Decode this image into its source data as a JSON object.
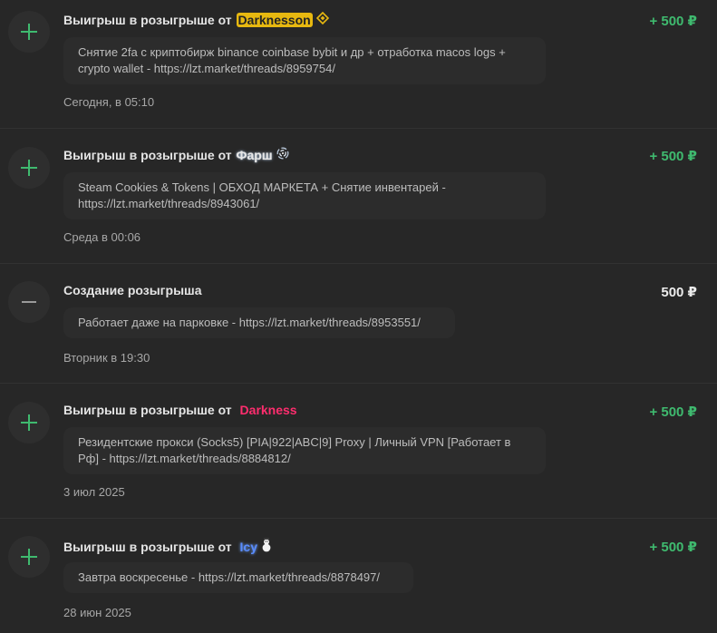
{
  "colors": {
    "background": "#272727",
    "positive_amount": "#3fba6f",
    "plus_icon": "#3fba6f",
    "minus_icon": "#9a9a9a",
    "darknesson_badge": "#e7b810",
    "darkness_name": "#ff2d6e",
    "icy_name": "#5a8cff"
  },
  "entries": [
    {
      "icon": "plus-icon",
      "title_prefix": "Выигрыш в розыгрыше от",
      "username": "Darknesson",
      "username_badge_icon": "binance-diamond-icon",
      "amount": "+ 500 ₽",
      "description": "Снятие 2fa с криптобирж binance coinbase bybit и др + отработка macos logs + crypto wallet - https://lzt.market/threads/8959754/",
      "date": "Сегодня, в 05:10"
    },
    {
      "icon": "plus-icon",
      "title_prefix": "Выигрыш в розыгрыше от",
      "username": "Фарш",
      "username_badge_icon": "swirl-icon",
      "amount": "+ 500 ₽",
      "description": "Steam Cookies & Tokens | ОБХОД МАРКЕТА + Снятие инвентарей - https://lzt.market/threads/8943061/",
      "date": "Среда в 00:06"
    },
    {
      "icon": "minus-icon",
      "title": "Создание розыгрыша",
      "amount": "500 ₽",
      "description": "Работает даже на парковке - https://lzt.market/threads/8953551/",
      "date": "Вторник в 19:30"
    },
    {
      "icon": "plus-icon",
      "title_prefix": "Выигрыш в розыгрыше от",
      "username": "Darkness",
      "amount": "+ 500 ₽",
      "description": "Резидентские прокси (Socks5) [PIA|922|ABC|9] Proxy | Личный VPN [Работает в Рф] - https://lzt.market/threads/8884812/",
      "date": "3 июл 2025"
    },
    {
      "icon": "plus-icon",
      "title_prefix": "Выигрыш в розыгрыше от",
      "username": "Icy",
      "username_badge_icon": "snowman-icon",
      "amount": "+ 500 ₽",
      "description": "Завтра воскресенье - https://lzt.market/threads/8878497/",
      "date": "28 июн 2025"
    }
  ]
}
